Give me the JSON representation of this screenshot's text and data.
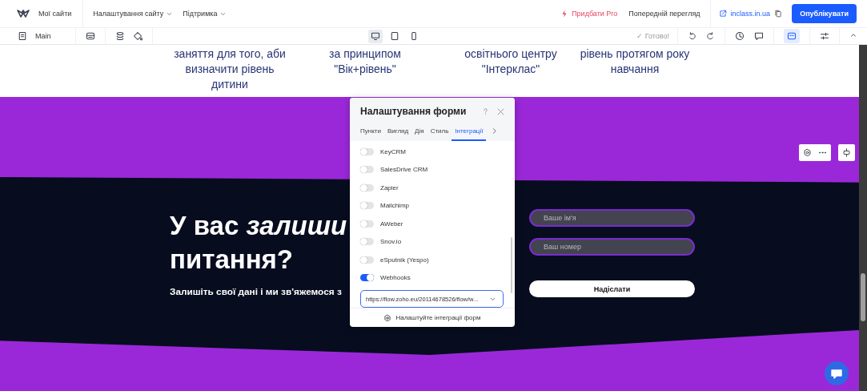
{
  "top_bar": {
    "logo_label": "Мої сайти",
    "menus": [
      {
        "label": "Налаштування сайту"
      },
      {
        "label": "Підтримка"
      }
    ],
    "upgrade": "Придбати Pro",
    "preview": "Попередній перегляд",
    "domain": "inclass.in.ua",
    "publish": "Опублікувати"
  },
  "toolbar": {
    "page": "Main",
    "devices": [
      {
        "kind": "desktop",
        "selected": true
      },
      {
        "kind": "tablet",
        "selected": false
      },
      {
        "kind": "phone",
        "selected": false
      }
    ],
    "status": "✓ Готово!",
    "panel_toggle": {
      "selected": true
    }
  },
  "content_columns": [
    {
      "text": "заняття для того, аби визначити рівень дитини"
    },
    {
      "text": "за принципом \"Вік+рівень\""
    },
    {
      "text": "освітнього центру \"Інтерклас\""
    },
    {
      "text": "рівень протягом року навчання"
    }
  ],
  "hero": {
    "title_line_1": "У вас *залиши*",
    "title_line_2": "питання?",
    "subtitle": "Залишіть свої дані і ми зв'яжемося з"
  },
  "form": {
    "fields": [
      {
        "placeholder": "Ваше ім'я"
      },
      {
        "placeholder": "Ваш номер"
      }
    ],
    "submit": "Надіслати"
  },
  "form_settings_panel": {
    "title": "Налаштування форми",
    "tabs": [
      {
        "label": "Пункти",
        "selected": false
      },
      {
        "label": "Вигляд",
        "selected": false
      },
      {
        "label": "Дія",
        "selected": false
      },
      {
        "label": "Стиль",
        "selected": false
      },
      {
        "label": "Інтеграції",
        "selected": true
      }
    ],
    "integrations": [
      {
        "name": "KeyCRM",
        "on": false
      },
      {
        "name": "SalesDrive CRM",
        "on": false
      },
      {
        "name": "Zapier",
        "on": false
      },
      {
        "name": "Mailchimp",
        "on": false
      },
      {
        "name": "AWeber",
        "on": false
      },
      {
        "name": "Snov.io",
        "on": false
      },
      {
        "name": "eSputnik (Yespo)",
        "on": false
      },
      {
        "name": "Webhooks",
        "on": true
      }
    ],
    "webhook_url": "https://flow.zoho.eu/20114678526/flow/w...",
    "footer": "Налаштуйте інтеграції форм"
  }
}
